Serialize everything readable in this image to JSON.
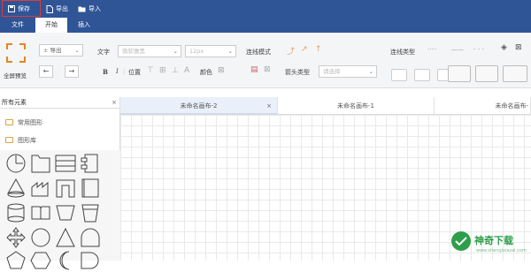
{
  "toolbar": {
    "save": "保存",
    "export": "导出",
    "import": "导入"
  },
  "menu": {
    "tabs": [
      "文件",
      "开始",
      "插入"
    ]
  },
  "ribbon": {
    "fullscreen": "全屏预览",
    "export_select": "导出",
    "text_label": "文字",
    "font_select": "微软雅黑",
    "size_select": "12px",
    "line_mode": "连线模式",
    "bold": "B",
    "italic": "I",
    "position": "位置",
    "color": "颜色",
    "arrow_type": "箭头类型",
    "arrow_select": "请选择",
    "line_type": "连线类型"
  },
  "sidebar": {
    "header": "所有元素",
    "groups": [
      "常用图形",
      "图形库"
    ]
  },
  "canvas_tabs": [
    {
      "label": "未命名画布-2",
      "close": "×"
    },
    {
      "label": "未命名画布-1"
    },
    {
      "label": "未命名画布-"
    }
  ],
  "watermark": {
    "text": "神奇下载",
    "sub": "www.shenqixiazai.com"
  },
  "colors": {
    "header": "#2f5597",
    "highlight": "#e03a3a",
    "watermark": "#2e9e4a"
  }
}
